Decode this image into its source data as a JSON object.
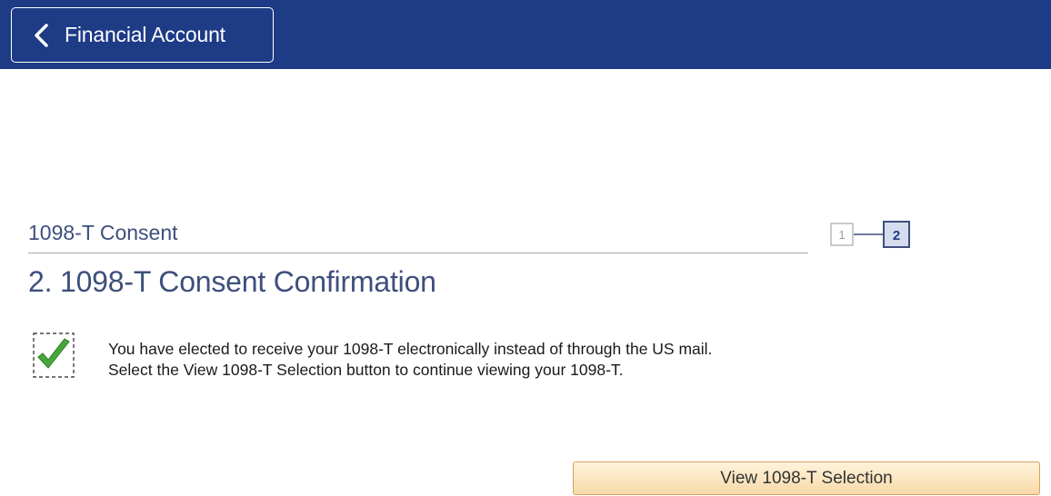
{
  "header": {
    "back_label": "Financial Account",
    "background_color": "#1e3b86"
  },
  "section": {
    "label": "1098-T Consent"
  },
  "steps": {
    "items": [
      "1",
      "2"
    ],
    "current": 2
  },
  "page": {
    "title": "2. 1098-T Consent Confirmation"
  },
  "message": {
    "icon": "check-icon",
    "line1": "You have elected to receive your 1098-T electronically instead of through the US mail.",
    "line2": "Select the View 1098-T Selection button to continue viewing your 1098-T."
  },
  "actions": {
    "view_button_label": "View 1098-T Selection"
  }
}
